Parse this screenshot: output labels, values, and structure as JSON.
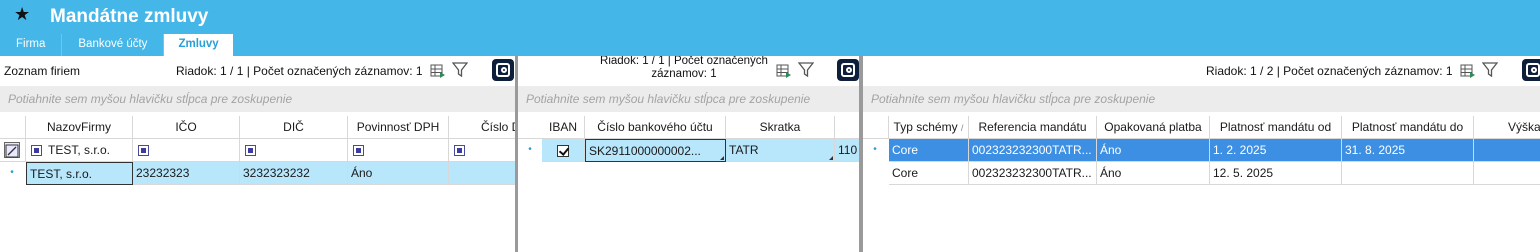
{
  "window": {
    "title": "Mandátne zmluvy",
    "star": "★"
  },
  "tabs": [
    {
      "label": "Firma",
      "active": false
    },
    {
      "label": "Bankové účty",
      "active": false
    },
    {
      "label": "Zmluvy",
      "active": true
    }
  ],
  "pane_firms": {
    "title": "Zoznam firiem",
    "row_info": "Riadok: 1 / 1 | Počet označených záznamov: 1",
    "group_hint": "Potiahnite sem myšou hlavičku stĺpca pre zoskupenie",
    "columns": [
      "NazovFirmy",
      "IČO",
      "DIČ",
      "Povinnosť DPH",
      "Číslo D"
    ],
    "filter_row": {
      "name": "TEST, s.r.o."
    },
    "rows": [
      {
        "name": "TEST, s.r.o.",
        "ico": "23232323",
        "dic": "3232323232",
        "dph": "Áno",
        "cislo": ""
      }
    ]
  },
  "pane_accounts": {
    "row_info_line1": "Riadok: 1 / 1 | Počet označených",
    "row_info_line2": "záznamov: 1",
    "group_hint": "Potiahnite sem myšou hlavičku stĺpca pre zoskupenie",
    "columns": [
      "IBAN",
      "Číslo bankového účtu",
      "Skratka",
      ""
    ],
    "rows": [
      {
        "iban_checked": true,
        "account": "SK2911000000002...",
        "code": "TATR",
        "extra": "110"
      }
    ]
  },
  "pane_contracts": {
    "row_info": "Riadok: 1 / 2 | Počet označených záznamov: 1",
    "group_hint": "Potiahnite sem myšou hlavičku stĺpca pre zoskupenie",
    "columns": [
      "Typ schémy",
      "Referencia mandátu",
      "Opakovaná platba",
      "Platnosť mandátu od",
      "Platnosť mandátu do",
      "Výška lim"
    ],
    "rows": [
      {
        "scheme": "Core",
        "ref": "002323232300TATR...",
        "recurring": "Áno",
        "from": "1. 2. 2025",
        "to": "31. 8. 2025",
        "limit": ""
      },
      {
        "scheme": "Core",
        "ref": "002323232300TATR...",
        "recurring": "Áno",
        "from": "12. 5. 2025",
        "to": "",
        "limit": ""
      }
    ]
  },
  "icons": {
    "row_indicator": "•",
    "sort_indicator": "/"
  },
  "colors": {
    "header_blue": "#45b6e8",
    "selected_row": "#b8e6fb",
    "active_row": "#3c8fe3"
  }
}
